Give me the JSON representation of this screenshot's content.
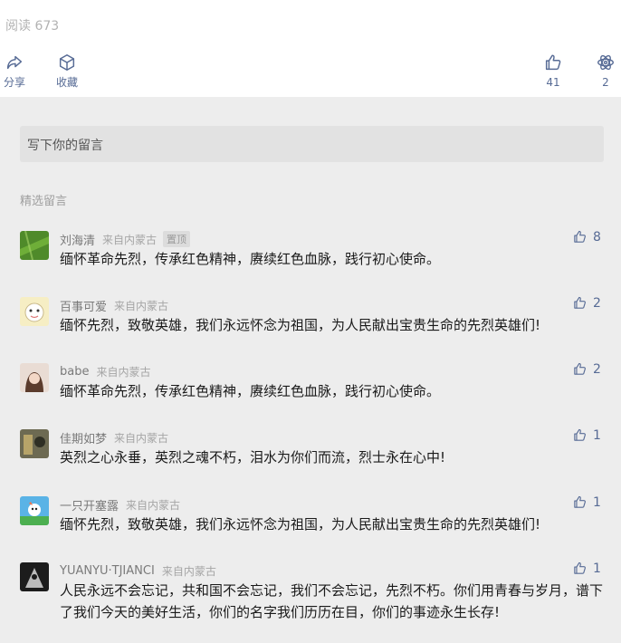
{
  "article": {
    "read_label": "阅读 673"
  },
  "actions": {
    "share": {
      "label": "分享",
      "icon": "share-icon"
    },
    "favorite": {
      "label": "收藏",
      "icon": "cube-icon"
    },
    "like": {
      "count": "41",
      "icon": "thumbs-up-icon"
    },
    "watch": {
      "count": "2",
      "icon": "wow-icon"
    }
  },
  "comment_input": {
    "placeholder": "写下你的留言"
  },
  "comments_section": {
    "title": "精选留言"
  },
  "comments": [
    {
      "nickname": "刘海清",
      "location": "来自内蒙古",
      "badge": "置顶",
      "text": "缅怀革命先烈，传承红色精神，赓续红色血脉，践行初心使命。",
      "likes": "8"
    },
    {
      "nickname": "百事可爱",
      "location": "来自内蒙古",
      "text": "缅怀先烈，致敬英雄，我们永远怀念为祖国，为人民献出宝贵生命的先烈英雄们!",
      "likes": "2"
    },
    {
      "nickname": "babe",
      "location": "来自内蒙古",
      "text": "缅怀革命先烈，传承红色精神，赓续红色血脉，践行初心使命。",
      "likes": "2"
    },
    {
      "nickname": "佳期如梦",
      "location": "来自内蒙古",
      "text": "英烈之心永垂，英烈之魂不朽，泪水为你们而流，烈士永在心中!",
      "likes": "1"
    },
    {
      "nickname": "一只开塞露",
      "location": "来自内蒙古",
      "text": "缅怀先烈，致敬英雄，我们永远怀念为祖国，为人民献出宝贵生命的先烈英雄们!",
      "likes": "1"
    },
    {
      "nickname": "YUANYU·TJIANCI",
      "location": "来自内蒙古",
      "text": "人民永远不会忘记，共和国不会忘记，我们不会忘记，先烈不朽。你们用青春与岁月，谱下了我们今天的美好生活，你们的名字我们历历在目，你们的事迹永生长存!",
      "likes": "1"
    }
  ],
  "colors": {
    "link": "#576b95",
    "background": "#ededed"
  }
}
